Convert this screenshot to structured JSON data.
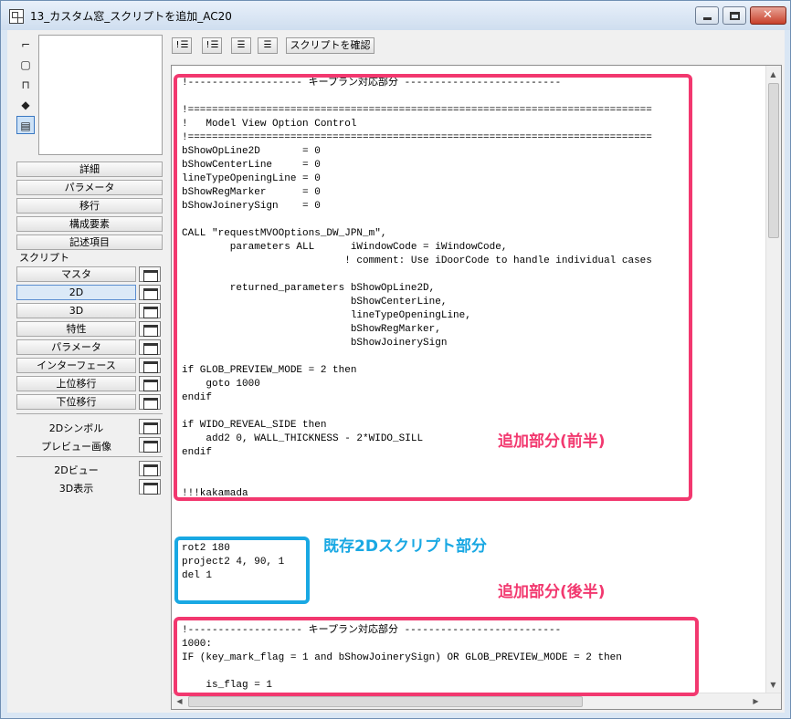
{
  "window": {
    "title": "13_カスタム窓_スクリプトを追加_AC20"
  },
  "view_icons": [
    "2d-view-icon",
    "3d-box-icon",
    "section-icon",
    "3d-model-icon",
    "script-list-icon"
  ],
  "panel": {
    "top_buttons": [
      "詳細",
      "パラメータ",
      "移行",
      "構成要素",
      "記述項目"
    ],
    "script_header": "スクリプト",
    "script_buttons": [
      "マスタ",
      "2D",
      "3D",
      "特性",
      "パラメータ",
      "インターフェース",
      "上位移行",
      "下位移行"
    ],
    "selected_script": "2D",
    "bottom_items": [
      "2Dシンボル",
      "プレビュー画像",
      "2Dビュー",
      "3D表示"
    ]
  },
  "toolbar": {
    "buttons": [
      "!☰",
      "!☰",
      "☰",
      "☰"
    ],
    "check_label": "スクリプトを確認"
  },
  "code_lines": [
    "!------------------- キープラン対応部分 --------------------------",
    "",
    "!=============================================================================",
    "!   Model View Option Control",
    "!=============================================================================",
    "bShowOpLine2D       = 0",
    "bShowCenterLine     = 0",
    "lineTypeOpeningLine = 0",
    "bShowRegMarker      = 0",
    "bShowJoinerySign    = 0",
    "",
    "CALL \"requestMVOOptions_DW_JPN_m\",",
    "        parameters ALL      iWindowCode = iWindowCode,",
    "                           ! comment: Use iDoorCode to handle individual cases",
    "",
    "        returned_parameters bShowOpLine2D,",
    "                            bShowCenterLine,",
    "                            lineTypeOpeningLine,",
    "                            bShowRegMarker,",
    "                            bShowJoinerySign",
    "",
    "if GLOB_PREVIEW_MODE = 2 then",
    "    goto 1000",
    "endif",
    "",
    "if WIDO_REVEAL_SIDE then",
    "    add2 0, WALL_THICKNESS - 2*WIDO_SILL",
    "endif",
    "",
    "",
    "!!!kakamada",
    "",
    "",
    "",
    "rot2 180",
    "project2 4, 90, 1",
    "del 1",
    "",
    "",
    "",
    "!------------------- キープラン対応部分 --------------------------",
    "1000:",
    "IF (key_mark_flag = 1 and bShowJoinerySign) OR GLOB_PREVIEW_MODE = 2 then",
    "",
    "    is_flag = 1"
  ],
  "annotations": {
    "added_first": "追加部分(前半)",
    "existing": "既存2Dスクリプト部分",
    "added_second": "追加部分(後半)",
    "colors": {
      "pink": "#f2386f",
      "blue": "#19a8e3"
    }
  }
}
